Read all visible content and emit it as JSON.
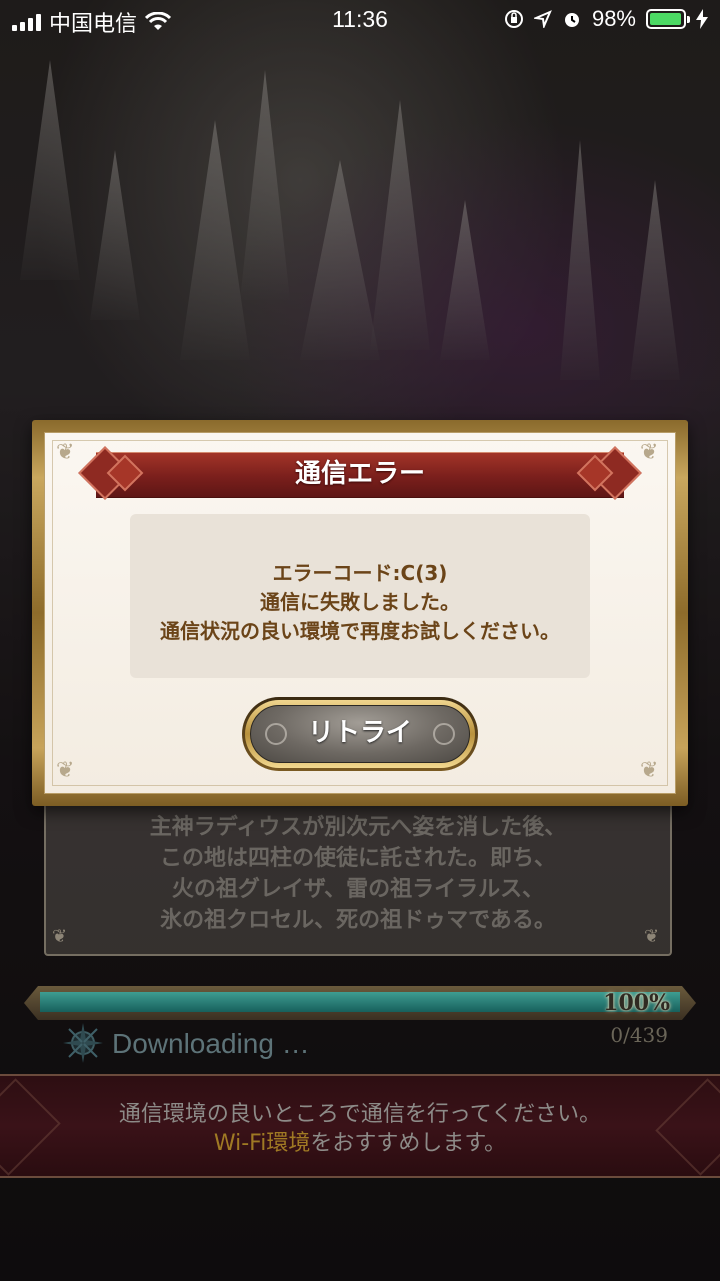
{
  "status_bar": {
    "carrier": "中国电信",
    "time": "11:36",
    "battery_percent": "98%",
    "icons": [
      "signal-icon",
      "wifi-icon",
      "orientation-lock-icon",
      "location-icon",
      "alarm-icon",
      "battery-icon",
      "charging-icon"
    ]
  },
  "dialog": {
    "title": "通信エラー",
    "error_code": "エラーコード:C(3)",
    "message_line1": "通信に失敗しました。",
    "message_line2": "通信状況の良い環境で再度お試しください。",
    "retry_label": "リトライ"
  },
  "story": {
    "lines": [
      "主神ラディウスが別次元へ姿を消した後、",
      "この地は四柱の使徒に託された。即ち、",
      "火の祖グレイザ、雷の祖ライラルス、",
      "氷の祖クロセル、死の祖ドゥマである。"
    ]
  },
  "download": {
    "percent": "100%",
    "percent_value": 100,
    "count": "0/439",
    "label": "Downloading …"
  },
  "banner": {
    "line1": "通信環境の良いところで通信を行ってください。",
    "line2_highlight": "Wi-Fi環境",
    "line2_rest": "をおすすめします。"
  },
  "colors": {
    "dialog_title_red": "#7a1f1c",
    "message_brown": "#6b4418",
    "progress_teal": "#2f8a80",
    "banner_highlight": "#a07a24",
    "battery_green": "#4cd964"
  }
}
